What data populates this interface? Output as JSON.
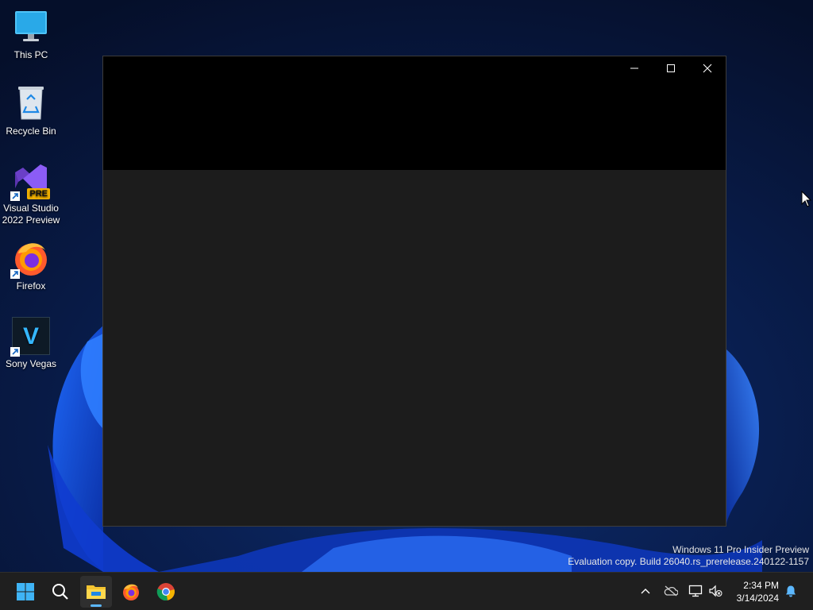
{
  "desktop": {
    "icons": [
      {
        "label": "This PC",
        "icon": "computer-monitor-icon"
      },
      {
        "label": "Recycle Bin",
        "icon": "recycle-bin-icon"
      },
      {
        "label": "Visual Studio 2022 Preview",
        "icon": "visual-studio-icon",
        "badge": "PRE"
      },
      {
        "label": "Firefox",
        "icon": "firefox-icon"
      },
      {
        "label": "Sony Vegas",
        "icon": "vegas-icon",
        "glyph": "V"
      }
    ]
  },
  "window": {
    "minimize_icon": "minimize-icon",
    "maximize_icon": "maximize-icon",
    "close_icon": "close-icon"
  },
  "watermark": {
    "line1": "Windows 11 Pro Insider Preview",
    "line2": "Evaluation copy. Build 26040.rs_prerelease.240122-1157"
  },
  "taskbar": {
    "apps": [
      "start-icon",
      "search-icon",
      "file-explorer-icon",
      "firefox-icon",
      "chrome-icon"
    ],
    "tray_icons": [
      "chevron-up-icon",
      "onedrive-icon",
      "network-icon",
      "volume-muted-icon",
      "notification-bell-icon"
    ],
    "time": "2:34 PM",
    "date": "3/14/2024"
  },
  "colors": {
    "accent": "#5cb8ff",
    "taskbar": "#1f1f1f",
    "window_title": "#000000",
    "window_body": "#1c1c1c",
    "desktop": "#071430"
  }
}
